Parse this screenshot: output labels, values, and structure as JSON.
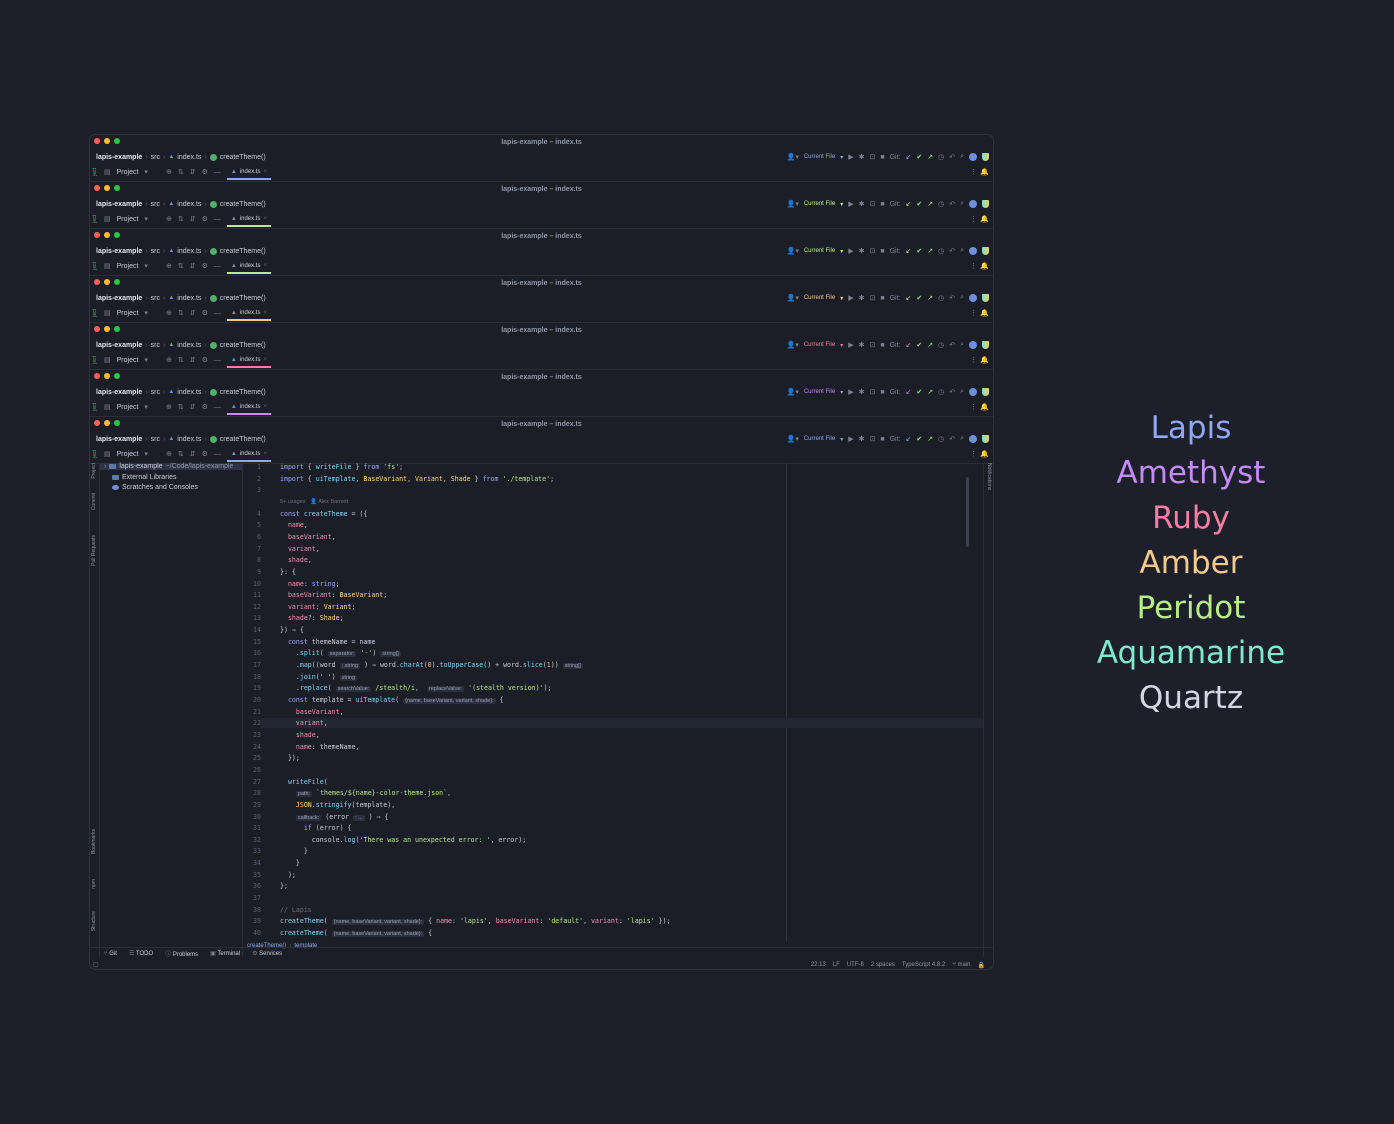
{
  "title": "lapis-example – index.ts",
  "breadcrumb": {
    "project": "lapis-example",
    "src": "src",
    "file": "index.ts",
    "fn": "createTheme()"
  },
  "toolbar": {
    "run_config": "Current File",
    "git_label": "Git:"
  },
  "tabs": {
    "project": "Project",
    "file": "index.ts"
  },
  "themes": [
    {
      "name": "Lapis",
      "color": "#8fa8f0"
    },
    {
      "name": "Amethyst",
      "color": "#c58af5"
    },
    {
      "name": "Ruby",
      "color": "#f47fa4"
    },
    {
      "name": "Amber",
      "color": "#f5c98a"
    },
    {
      "name": "Peridot",
      "color": "#b8ef84"
    },
    {
      "name": "Aquamarine",
      "color": "#7eeacb"
    },
    {
      "name": "Quartz",
      "color": "#d4d8e6"
    }
  ],
  "tree": {
    "root": "lapis-example",
    "root_path": "~/Code/lapis-example",
    "external": "External Libraries",
    "scratches": "Scratches and Consoles"
  },
  "left_tools": [
    "Project",
    "Commit",
    "Pull Requests",
    "Bookmarks",
    "npm",
    "Structure"
  ],
  "right_tools": [
    "Notifications"
  ],
  "code": {
    "usages": "5+ usages",
    "author": "Alex Barnett",
    "hint_name_line": "{name, baseVariant, variant, shade}"
  },
  "editor_crumb": {
    "a": "createTheme()",
    "b": "template"
  },
  "tool_windows": [
    "Git",
    "TODO",
    "Problems",
    "Terminal",
    "Services"
  ],
  "status": {
    "pos": "22:13",
    "eol": "LF",
    "enc": "UTF-8",
    "indent": "2 spaces",
    "lang": "TypeScript 4.8.2",
    "branch": "main"
  }
}
